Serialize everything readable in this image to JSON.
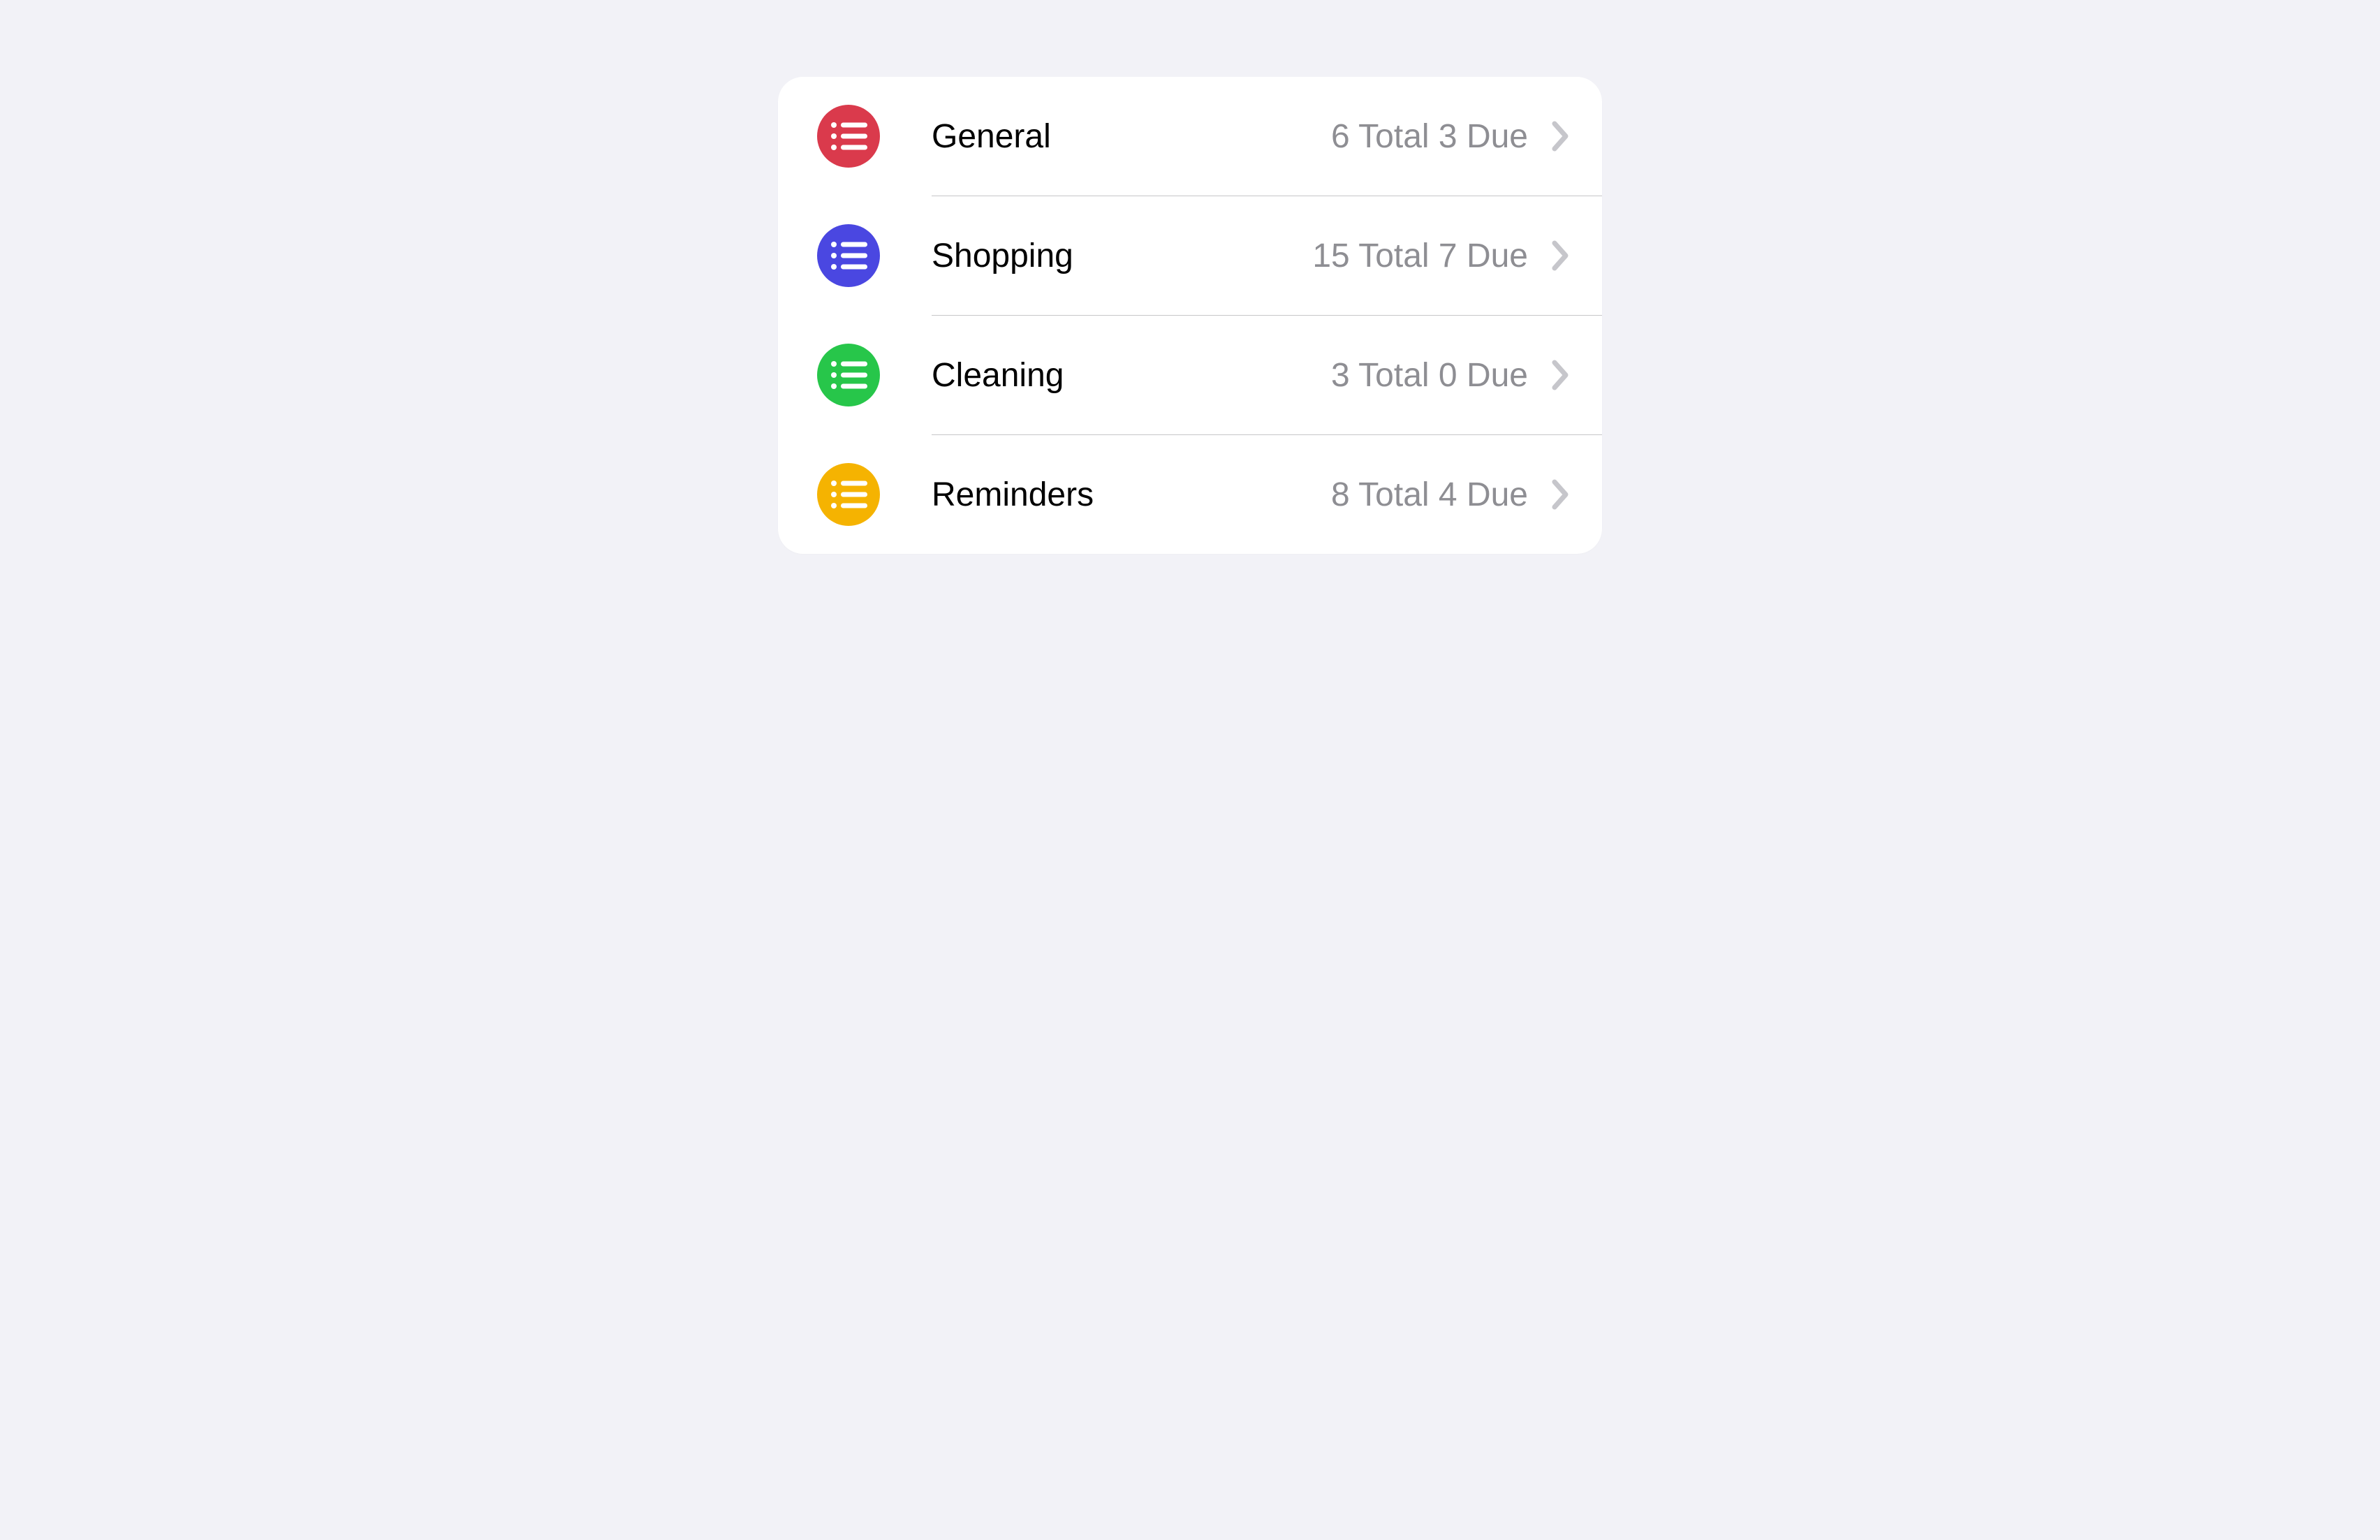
{
  "lists": [
    {
      "name": "General",
      "total": 6,
      "due": 3,
      "color": "#da3a4c"
    },
    {
      "name": "Shopping",
      "total": 15,
      "due": 7,
      "color": "#4a47e1"
    },
    {
      "name": "Cleaning",
      "total": 3,
      "due": 0,
      "color": "#27c64a"
    },
    {
      "name": "Reminders",
      "total": 8,
      "due": 4,
      "color": "#f5b301"
    }
  ],
  "stats_format": "{total} Total {due} Due"
}
